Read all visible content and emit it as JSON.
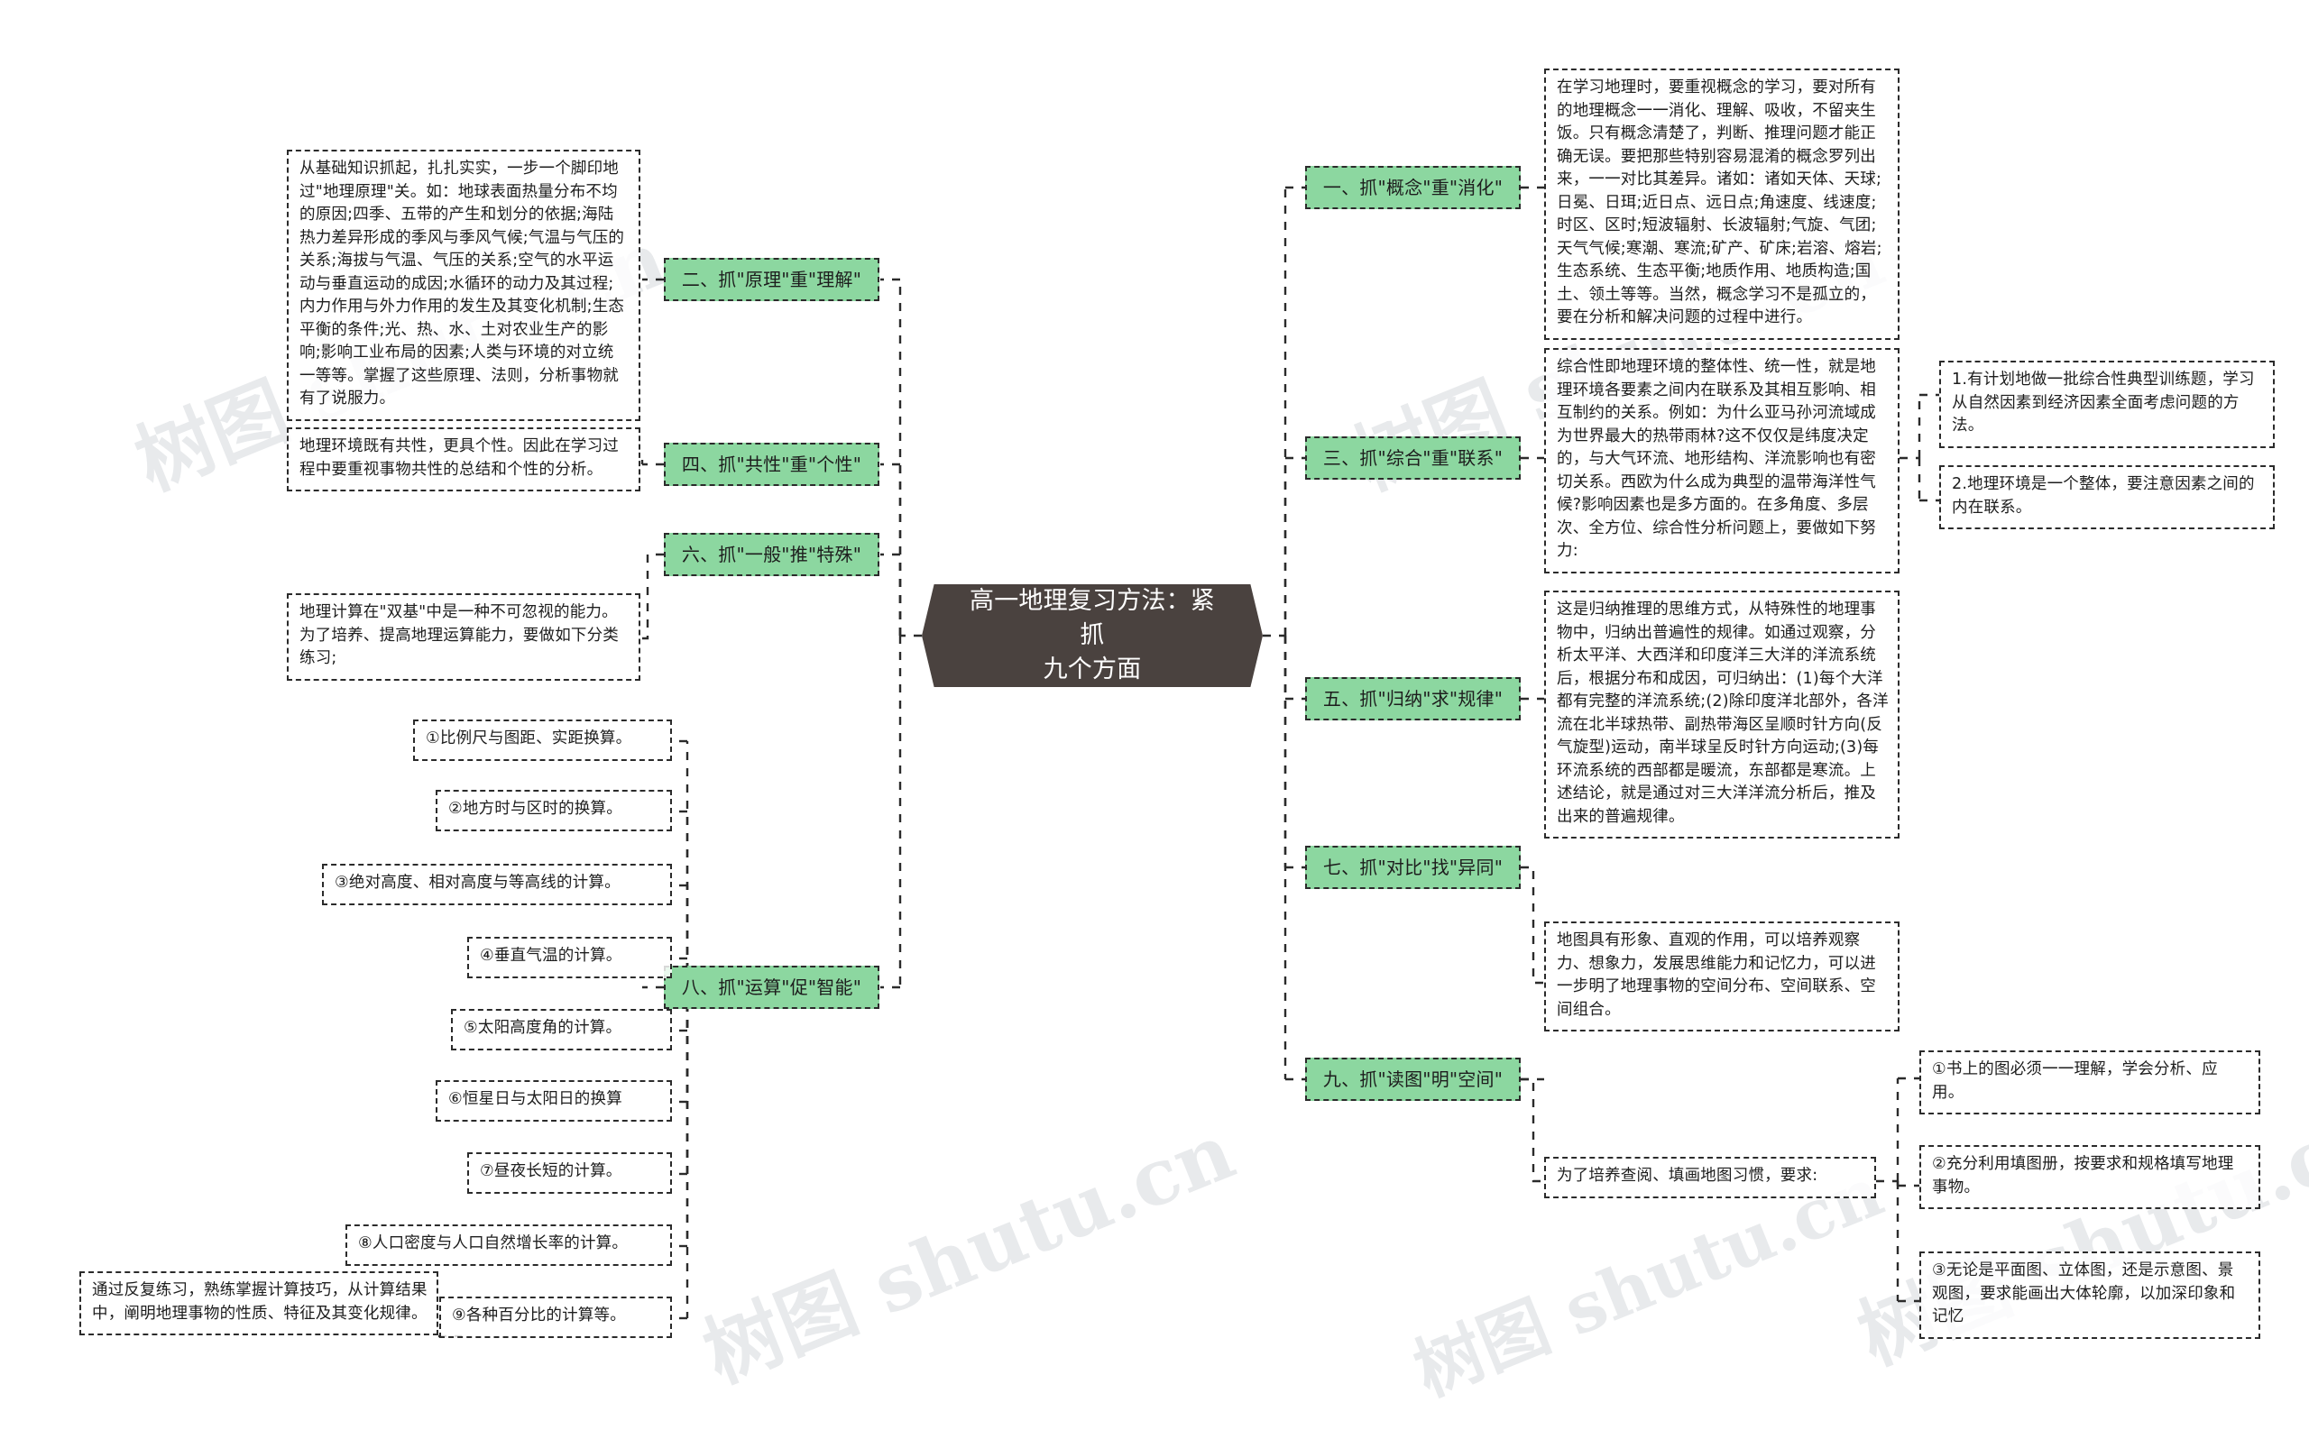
{
  "meta": {
    "watermark_text": "树图 shutu.cn"
  },
  "center": {
    "title": "高一地理复习方法：紧抓\n九个方面"
  },
  "branches_right": [
    {
      "label": "一、抓\"概念\"重\"消化\""
    },
    {
      "label": "三、抓\"综合\"重\"联系\""
    },
    {
      "label": "五、抓\"归纳\"求\"规律\""
    },
    {
      "label": "七、抓\"对比\"找\"异同\""
    },
    {
      "label": "九、抓\"读图\"明\"空间\""
    }
  ],
  "branches_left": [
    {
      "label": "二、抓\"原理\"重\"理解\""
    },
    {
      "label": "四、抓\"共性\"重\"个性\""
    },
    {
      "label": "六、抓\"一般\"推\"特殊\""
    },
    {
      "label": "八、抓\"运算\"促\"智能\""
    }
  ],
  "left_details": {
    "principle": "从基础知识抓起，扎扎实实，一步一个脚印地过\"地理原理\"关。如：地球表面热量分布不均的原因;四季、五带的产生和划分的依据;海陆热力差异形成的季风与季风气候;气温与气压的关系;海拔与气温、气压的关系;空气的水平运动与垂直运动的成因;水循环的动力及其过程;内力作用与外力作用的发生及其变化机制;生态平衡的条件;光、热、水、土对农业生产的影响;影响工业布局的因素;人类与环境的对立统一等等。掌握了这些原理、法则，分析事物就有了说服力。",
    "commonality": "地理环境既有共性，更具个性。因此在学习过程中要重视事物共性的总结和个性的分析。",
    "calc_intro": "地理计算在\"双基\"中是一种不可忽视的能力。为了培养、提高地理运算能力，要做如下分类练习;",
    "calc_items": [
      "①比例尺与图距、实距换算。",
      "②地方时与区时的换算。",
      "③绝对高度、相对高度与等高线的计算。",
      "④垂直气温的计算。",
      "⑤太阳高度角的计算。",
      "⑥恒星日与太阳日的换算",
      "⑦昼夜长短的计算。",
      "⑧人口密度与人口自然增长率的计算。",
      "⑨各种百分比的计算等。"
    ],
    "calc_conclusion": "通过反复练习，熟练掌握计算技巧，从计算结果中，阐明地理事物的性质、特征及其变化规律。"
  },
  "right_details": {
    "concept": "在学习地理时，要重视概念的学习，要对所有的地理概念一一消化、理解、吸收，不留夹生饭。只有概念清楚了，判断、推理问题才能正确无误。要把那些特别容易混淆的概念罗列出来，一一对比其差异。诸如：诸如天体、天球;日冕、日珥;近日点、远日点;角速度、线速度;时区、区时;短波辐射、长波辐射;气旋、气团;天气气候;寒潮、寒流;矿产、矿床;岩溶、熔岩;生态系统、生态平衡;地质作用、地质构造;国土、领土等等。当然，概念学习不是孤立的，要在分析和解决问题的过程中进行。",
    "comprehensive": "综合性即地理环境的整体性、统一性，就是地理环境各要素之间内在联系及其相互影响、相互制约的关系。例如：为什么亚马孙河流域成为世界最大的热带雨林?这不仅仅是纬度决定的，与大气环流、地形结构、洋流影响也有密切关系。西欧为什么成为典型的温带海洋性气候?影响因素也是多方面的。在多角度、多层次、全方位、综合性分析问题上，要做如下努力:",
    "comprehensive_items": [
      "1.有计划地做一批综合性典型训练题，学习从自然因素到经济因素全面考虑问题的方法。",
      "2.地理环境是一个整体，要注意因素之间的内在联系。"
    ],
    "induction": "这是归纳推理的思维方式，从特殊性的地理事物中，归纳出普遍性的规律。如通过观察，分析太平洋、大西洋和印度洋三大洋的洋流系统后，根据分布和成因，可归纳出：(1)每个大洋都有完整的洋流系统;(2)除印度洋北部外，各洋流在北半球热带、副热带海区呈顺时针方向(反气旋型)运动，南半球呈反时针方向运动;(3)每环流系统的西部都是暖流，东部都是寒流。上述结论，就是通过对三大洋洋流分析后，推及出来的普遍规律。",
    "map_reading": "地图具有形象、直观的作用，可以培养观察力、想象力，发展思维能力和记忆力，可以进一步明了地理事物的空间分布、空间联系、空间组合。",
    "map_habit": "为了培养查阅、填画地图习惯，要求:",
    "map_items": [
      "①书上的图必须一一理解，学会分析、应用。",
      "②充分利用填图册，按要求和规格填写地理事物。",
      "③无论是平面图、立体图，还是示意图、景观图，要求能画出大体轮廓，以加深印象和记忆"
    ]
  }
}
